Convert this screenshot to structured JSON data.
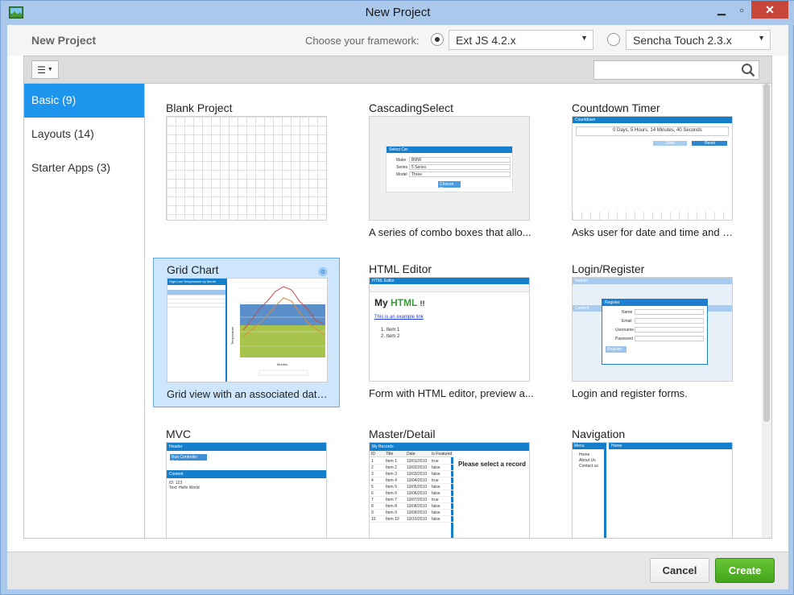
{
  "window": {
    "title": "New Project"
  },
  "header": {
    "title": "New Project",
    "framework_label": "Choose your framework:",
    "frameworks": [
      {
        "label": "Ext JS 4.2.x",
        "selected": true
      },
      {
        "label": "Sencha Touch 2.3.x",
        "selected": false
      }
    ]
  },
  "sidebar": {
    "items": [
      {
        "label": "Basic (9)",
        "active": true
      },
      {
        "label": "Layouts (14)",
        "active": false
      },
      {
        "label": "Starter Apps (3)",
        "active": false
      }
    ]
  },
  "templates": [
    {
      "title": "Blank Project",
      "desc": ""
    },
    {
      "title": "CascadingSelect",
      "desc": "A series of combo boxes that allo..."
    },
    {
      "title": "Countdown Timer",
      "desc": "Asks user for date and time and di..."
    },
    {
      "title": "Grid Chart",
      "desc": "Grid view with an associated data ...",
      "selected": true
    },
    {
      "title": "HTML Editor",
      "desc": "Form with HTML editor, preview a..."
    },
    {
      "title": "Login/Register",
      "desc": "Login and register forms."
    },
    {
      "title": "MVC",
      "desc": ""
    },
    {
      "title": "Master/Detail",
      "desc": ""
    },
    {
      "title": "Navigation",
      "desc": ""
    }
  ],
  "thumbs": {
    "cascading": {
      "header": "Select Car",
      "make_label": "Make",
      "make": "BMW",
      "series_label": "Series",
      "series": "5 Series",
      "model_label": "Model",
      "model": "Three",
      "button": "Choose Car"
    },
    "countdown": {
      "header": "Countdown",
      "text": "0 Days, 5 Hours, 14 Minutes, 40 Seconds",
      "start": "Start",
      "reset": "Reset"
    },
    "gridchart": {
      "grid_title": "High-Low Temperature by Month",
      "xlabel": "Months",
      "ylabel": "Temperature"
    },
    "htmleditor": {
      "header": "HTML Editor",
      "heading_my": "My",
      "heading_html": "HTML",
      "heading_bang": "!!",
      "link": "This is an example link",
      "item1": "Item 1",
      "item2": "Item 2"
    },
    "login": {
      "header": "Header",
      "content": "Content",
      "dialog": "Register",
      "name": "Name",
      "email": "Email",
      "username": "Username",
      "password": "Password",
      "button": "Register"
    },
    "mvc": {
      "header": "Header",
      "button": "Run Controller Action",
      "content": "Content",
      "line1": "ID: 123",
      "line2": "Text: Hello World"
    },
    "master": {
      "header": "My Records",
      "cols": [
        "ID",
        "Title",
        "Date",
        "Is Featured"
      ],
      "detail": "Please select a record",
      "rows": [
        [
          "1",
          "Item 1",
          "10/01/2010",
          "true"
        ],
        [
          "2",
          "Item 2",
          "10/02/2010",
          "false"
        ],
        [
          "3",
          "Item 3",
          "10/03/2010",
          "false"
        ],
        [
          "4",
          "Item 4",
          "10/04/2010",
          "true"
        ],
        [
          "5",
          "Item 5",
          "10/05/2010",
          "false"
        ],
        [
          "6",
          "Item 6",
          "10/06/2010",
          "false"
        ],
        [
          "7",
          "Item 7",
          "10/07/2010",
          "true"
        ],
        [
          "8",
          "Item 8",
          "10/08/2010",
          "false"
        ],
        [
          "9",
          "Item 9",
          "10/09/2010",
          "false"
        ],
        [
          "10",
          "Item 10",
          "10/10/2010",
          "false"
        ]
      ]
    },
    "navigation": {
      "menu": "Menu",
      "home": "Home",
      "links": [
        "Home",
        "About Us",
        "Contact us"
      ]
    }
  },
  "footer": {
    "cancel": "Cancel",
    "create": "Create"
  },
  "colors": {
    "accent": "#1e95ec",
    "create": "#4bae1f",
    "header_blue": "#157fcc"
  }
}
